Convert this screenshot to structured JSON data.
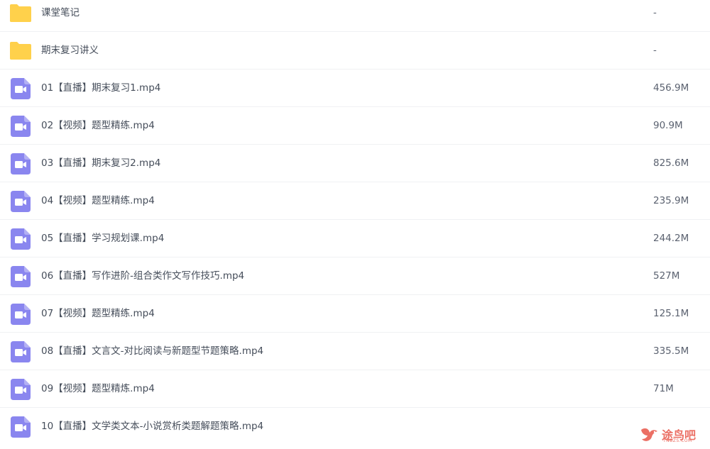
{
  "colors": {
    "folder": "#ffd04b",
    "video": "#8a86ef",
    "watermark": "#e8574a"
  },
  "files": [
    {
      "type": "folder",
      "icon": "folder-icon",
      "name": "课堂笔记",
      "size": "-"
    },
    {
      "type": "folder",
      "icon": "folder-icon",
      "name": "期末复习讲义",
      "size": "-"
    },
    {
      "type": "video",
      "icon": "video-file-icon",
      "name": "01【直播】期末复习1.mp4",
      "size": "456.9M"
    },
    {
      "type": "video",
      "icon": "video-file-icon",
      "name": "02【视频】题型精练.mp4",
      "size": "90.9M"
    },
    {
      "type": "video",
      "icon": "video-file-icon",
      "name": "03【直播】期末复习2.mp4",
      "size": "825.6M"
    },
    {
      "type": "video",
      "icon": "video-file-icon",
      "name": "04【视频】题型精练.mp4",
      "size": "235.9M"
    },
    {
      "type": "video",
      "icon": "video-file-icon",
      "name": "05【直播】学习规划课.mp4",
      "size": "244.2M"
    },
    {
      "type": "video",
      "icon": "video-file-icon",
      "name": "06【直播】写作进阶-组合类作文写作技巧.mp4",
      "size": "527M"
    },
    {
      "type": "video",
      "icon": "video-file-icon",
      "name": "07【视频】题型精练.mp4",
      "size": "125.1M"
    },
    {
      "type": "video",
      "icon": "video-file-icon",
      "name": "08【直播】文言文-对比阅读与新题型节题策略.mp4",
      "size": "335.5M"
    },
    {
      "type": "video",
      "icon": "video-file-icon",
      "name": "09【视频】题型精炼.mp4",
      "size": "71M"
    },
    {
      "type": "video",
      "icon": "video-file-icon",
      "name": "10【直播】文学类文本-小说赏析类题解题策略.mp4",
      "size": ""
    }
  ],
  "watermark": {
    "text": "途鸟吧",
    "subtext": "TNBZS.COM"
  }
}
